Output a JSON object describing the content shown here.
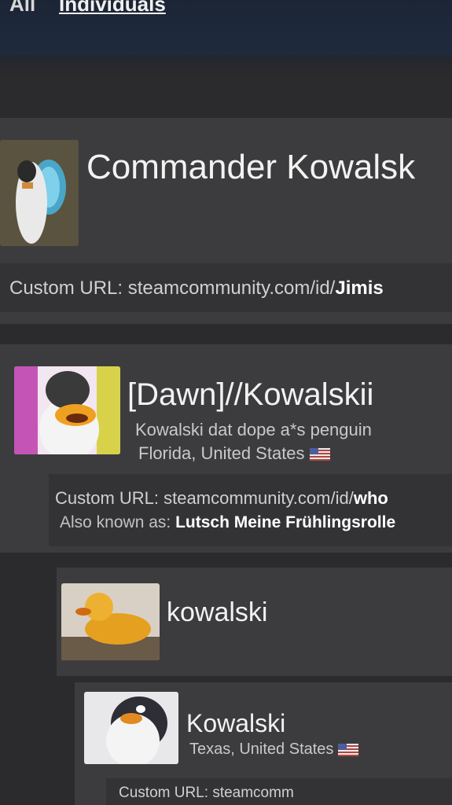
{
  "tabs": {
    "all": "All",
    "individuals": "Individuals"
  },
  "results": [
    {
      "name": "Commander Kowalsk",
      "custom_url_label": "Custom URL:",
      "custom_url_prefix": "steamcommunity.com/id/",
      "custom_url_id": "Jimis"
    },
    {
      "name": "[Dawn]//Kowalskii",
      "summary": "Kowalski dat dope a*s penguin",
      "location": "Florida, United States",
      "custom_url_label": "Custom URL:",
      "custom_url_prefix": "steamcommunity.com/id/",
      "custom_url_id": "who",
      "aka_label": "Also known as:",
      "aka_value": "Lutsch Meine Frühlingsrolle"
    },
    {
      "name": "kowalski"
    },
    {
      "name": "Kowalski",
      "location": "Texas, United States",
      "custom_url_label": "Custom URL:",
      "custom_url_prefix": "steamcomm"
    }
  ],
  "colors": {
    "page_bg": "#262628",
    "card_bg": "#3c3c3e",
    "url_bar_bg": "#333335",
    "text_primary": "#f2f2f2",
    "text_secondary": "#c9c9c9"
  },
  "icons": [
    "us-flag-icon"
  ]
}
